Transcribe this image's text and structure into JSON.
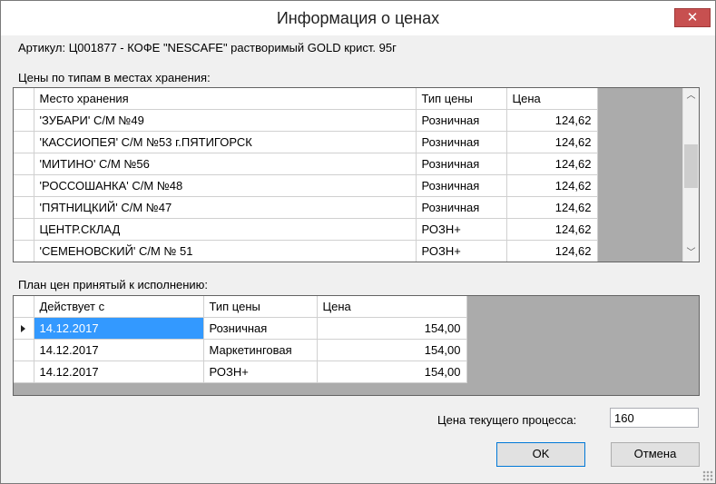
{
  "window": {
    "title": "Информация о ценах",
    "close_icon": "close-icon"
  },
  "article": {
    "text": "Артикул: Ц001877 - КОФЕ \"NESCAFE\" растворимый GOLD крист. 95г"
  },
  "storage_prices": {
    "label": "Цены по типам в местах хранения:",
    "columns": [
      "Место хранения",
      "Тип цены",
      "Цена"
    ],
    "rows": [
      [
        "'ЗУБАРИ' С/М №49",
        "Розничная",
        "124,62"
      ],
      [
        "'КАССИОПЕЯ' С/М №53 г.ПЯТИГОРСК",
        "Розничная",
        "124,62"
      ],
      [
        "'МИТИНО' С/М №56",
        "Розничная",
        "124,62"
      ],
      [
        "'РОССОШАНКА' С/М №48",
        "Розничная",
        "124,62"
      ],
      [
        "'ПЯТНИЦКИЙ' С/М №47",
        "Розничная",
        "124,62"
      ],
      [
        " ЦЕНТР.СКЛАД",
        "РОЗН+",
        "124,62"
      ],
      [
        "'СЕМЕНОВСКИЙ' С/М № 51",
        "РОЗН+",
        "124,62"
      ]
    ]
  },
  "price_plan": {
    "label": "План цен принятый к исполнению:",
    "columns": [
      "Действует с",
      "Тип цены",
      "Цена"
    ],
    "rows": [
      [
        "14.12.2017",
        "Розничная",
        "154,00"
      ],
      [
        "14.12.2017",
        "Маркетинговая",
        "154,00"
      ],
      [
        "14.12.2017",
        "РОЗН+",
        "154,00"
      ]
    ]
  },
  "current_process": {
    "label": "Цена текущего процесса:",
    "value": "160"
  },
  "buttons": {
    "ok": "OK",
    "cancel": "Отмена"
  }
}
